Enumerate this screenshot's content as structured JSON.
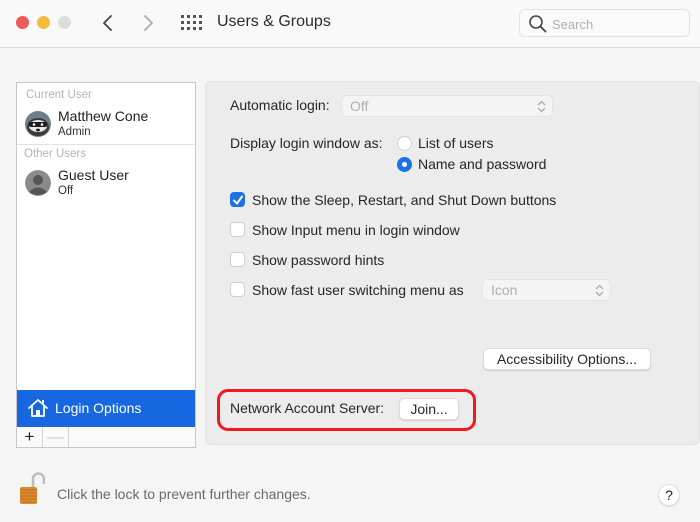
{
  "window": {
    "title": "Users & Groups",
    "search": {
      "placeholder": "Search",
      "value": ""
    }
  },
  "sidebar": {
    "current_user_label": "Current User",
    "other_users_label": "Other Users",
    "users": [
      {
        "name": "Matthew Cone",
        "role": "Admin",
        "avatar": "raccoon-photo"
      },
      {
        "name": "Guest User",
        "role": "Off",
        "avatar": "generic-person-icon"
      }
    ],
    "login_options_label": "Login Options",
    "add_label": "+",
    "remove_label": "—"
  },
  "login_options": {
    "automatic_login_label": "Automatic login:",
    "automatic_login_value": "Off",
    "display_login_label": "Display login window as:",
    "display_options": [
      {
        "label": "List of users",
        "selected": false
      },
      {
        "label": "Name and password",
        "selected": true
      }
    ],
    "checkboxes": [
      {
        "label": "Show the Sleep, Restart, and Shut Down buttons",
        "checked": true
      },
      {
        "label": "Show Input menu in login window",
        "checked": false
      },
      {
        "label": "Show password hints",
        "checked": false
      },
      {
        "label": "Show fast user switching menu as",
        "checked": false
      }
    ],
    "fast_switch_value": "Icon",
    "accessibility_button": "Accessibility Options...",
    "network_server_label": "Network Account Server:",
    "join_button": "Join..."
  },
  "footer": {
    "lock_text": "Click the lock to prevent further changes.",
    "help_label": "?"
  },
  "colors": {
    "accent": "#1767e0",
    "highlight_border": "#ee1c1c"
  }
}
